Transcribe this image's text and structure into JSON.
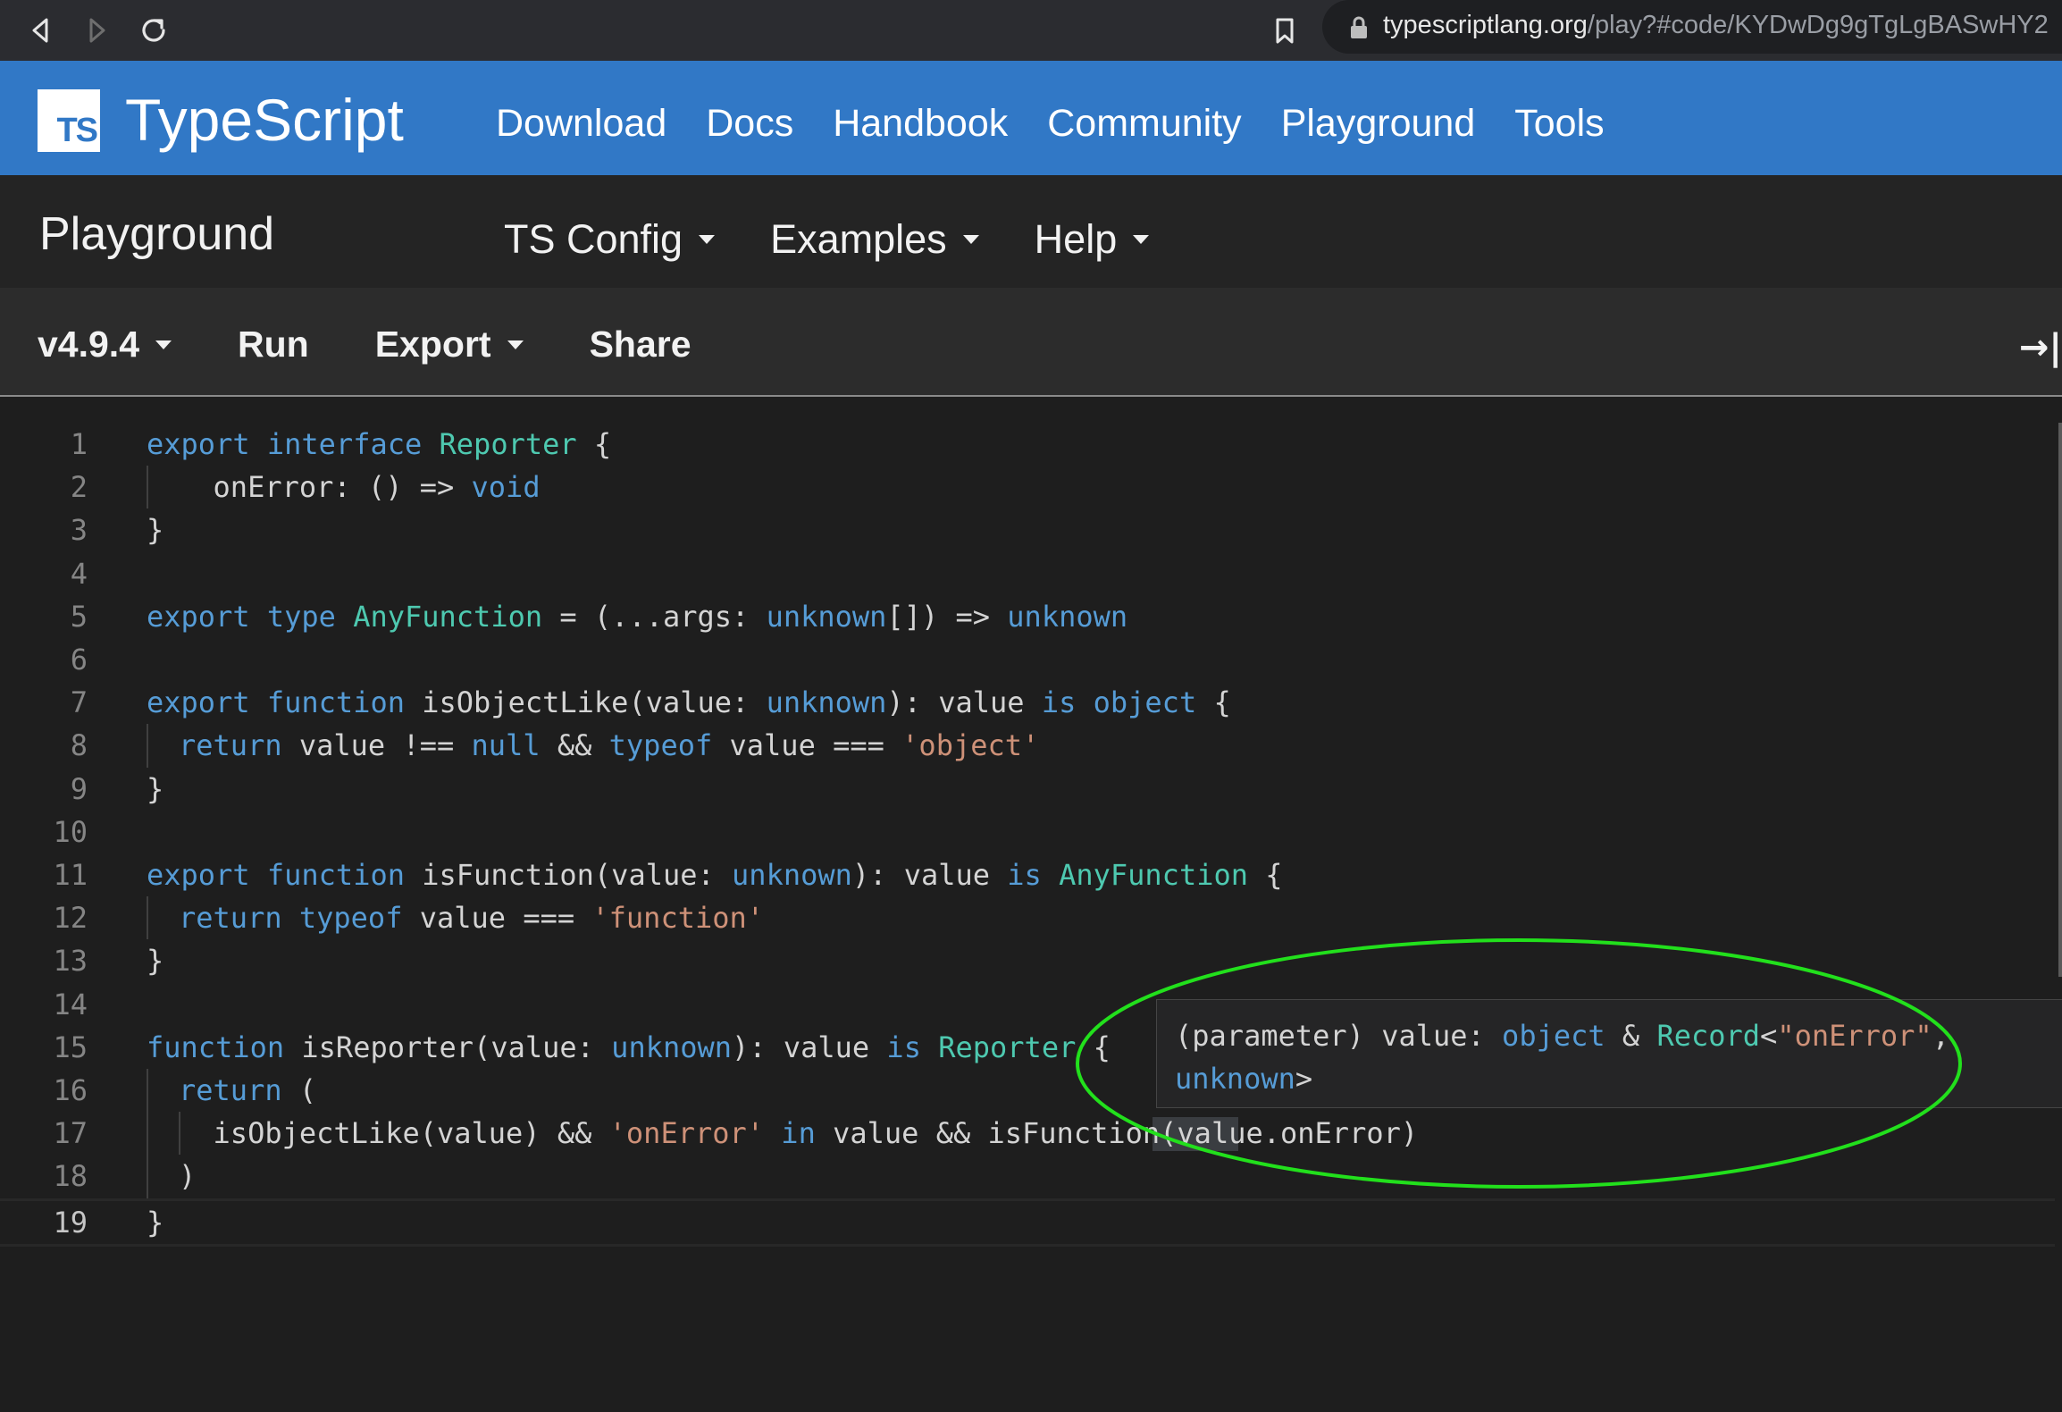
{
  "browser": {
    "url_domain": "typescriptlang.org",
    "url_path": "/play?#code/KYDwDg9gTgLgBASwHY2"
  },
  "site_nav": {
    "logo_text": "TS",
    "brand": "TypeScript",
    "links": [
      "Download",
      "Docs",
      "Handbook",
      "Community",
      "Playground",
      "Tools"
    ]
  },
  "playground": {
    "title": "Playground",
    "menus": [
      "TS Config",
      "Examples",
      "Help"
    ]
  },
  "toolbar": {
    "version": "v4.9.4",
    "run": "Run",
    "export": "Export",
    "share": "Share",
    "sidebar_toggle": "→|"
  },
  "editor": {
    "line_numbers": [
      "1",
      "2",
      "3",
      "4",
      "5",
      "6",
      "7",
      "8",
      "9",
      "10",
      "11",
      "12",
      "13",
      "14",
      "15",
      "16",
      "17",
      "18",
      "19"
    ],
    "active_line": "19",
    "lines": [
      {
        "p": [
          [
            "export",
            "k"
          ],
          [
            " "
          ],
          [
            "interface",
            "k"
          ],
          [
            " "
          ],
          [
            "Reporter",
            "t"
          ],
          [
            " {"
          ]
        ]
      },
      {
        "p": [
          [
            "  onError: () => "
          ],
          [
            "void",
            "k"
          ]
        ]
      },
      {
        "p": [
          [
            "}"
          ]
        ]
      },
      {
        "p": []
      },
      {
        "p": [
          [
            "export",
            "k"
          ],
          [
            " "
          ],
          [
            "type",
            "k"
          ],
          [
            " "
          ],
          [
            "AnyFunction",
            "t"
          ],
          [
            " = (...args: "
          ],
          [
            "unknown",
            "k"
          ],
          [
            "[]) => "
          ],
          [
            "unknown",
            "k"
          ]
        ]
      },
      {
        "p": []
      },
      {
        "p": [
          [
            "export",
            "k"
          ],
          [
            " "
          ],
          [
            "function",
            "k"
          ],
          [
            " isObjectLike(value: "
          ],
          [
            "unknown",
            "k"
          ],
          [
            "): value "
          ],
          [
            "is",
            "k"
          ],
          [
            " "
          ],
          [
            "object",
            "k"
          ],
          [
            " {"
          ]
        ]
      },
      {
        "p": [
          [
            "return",
            "k"
          ],
          [
            " value !== "
          ],
          [
            "null",
            "k"
          ],
          [
            " && "
          ],
          [
            "typeof",
            "k"
          ],
          [
            " value === "
          ],
          [
            "'object'",
            "s"
          ]
        ]
      },
      {
        "p": [
          [
            "}"
          ]
        ]
      },
      {
        "p": []
      },
      {
        "p": [
          [
            "export",
            "k"
          ],
          [
            " "
          ],
          [
            "function",
            "k"
          ],
          [
            " isFunction(value: "
          ],
          [
            "unknown",
            "k"
          ],
          [
            "): value "
          ],
          [
            "is",
            "k"
          ],
          [
            " "
          ],
          [
            "AnyFunction",
            "t"
          ],
          [
            " {"
          ]
        ]
      },
      {
        "p": [
          [
            "return",
            "k"
          ],
          [
            " "
          ],
          [
            "typeof",
            "k"
          ],
          [
            " value === "
          ],
          [
            "'function'",
            "s"
          ]
        ]
      },
      {
        "p": [
          [
            "}"
          ]
        ]
      },
      {
        "p": []
      },
      {
        "p": [
          [
            "function",
            "k"
          ],
          [
            " isReporter(value: "
          ],
          [
            "unknown",
            "k"
          ],
          [
            "): value "
          ],
          [
            "is",
            "k"
          ],
          [
            " "
          ],
          [
            "Reporter",
            "t"
          ],
          [
            " {"
          ]
        ]
      },
      {
        "p": [
          [
            "return",
            "k"
          ],
          [
            " ("
          ]
        ]
      },
      {
        "p": [
          [
            "  isObjectLike(value) && "
          ],
          [
            "'onError'",
            "s"
          ],
          [
            " "
          ],
          [
            "in",
            "k"
          ],
          [
            " value && isFunction(value.onError)"
          ]
        ]
      },
      {
        "p": [
          [
            ")"
          ]
        ]
      },
      {
        "p": [
          [
            "}"
          ]
        ]
      }
    ]
  },
  "hover_tooltip": {
    "line1": [
      [
        "(parameter) value: "
      ],
      [
        "object",
        "k"
      ],
      [
        " & "
      ],
      [
        "Record",
        "t"
      ],
      [
        "<"
      ],
      [
        "\"onError\"",
        "s"
      ],
      [
        ","
      ]
    ],
    "line2": [
      [
        "unknown",
        "k"
      ],
      [
        ">"
      ]
    ]
  },
  "colors": {
    "keyword": "#569cd6",
    "type": "#4ec9b0",
    "string": "#ce9178",
    "annotation_ellipse": "#22e01c",
    "nav_blue": "#3178c6"
  }
}
